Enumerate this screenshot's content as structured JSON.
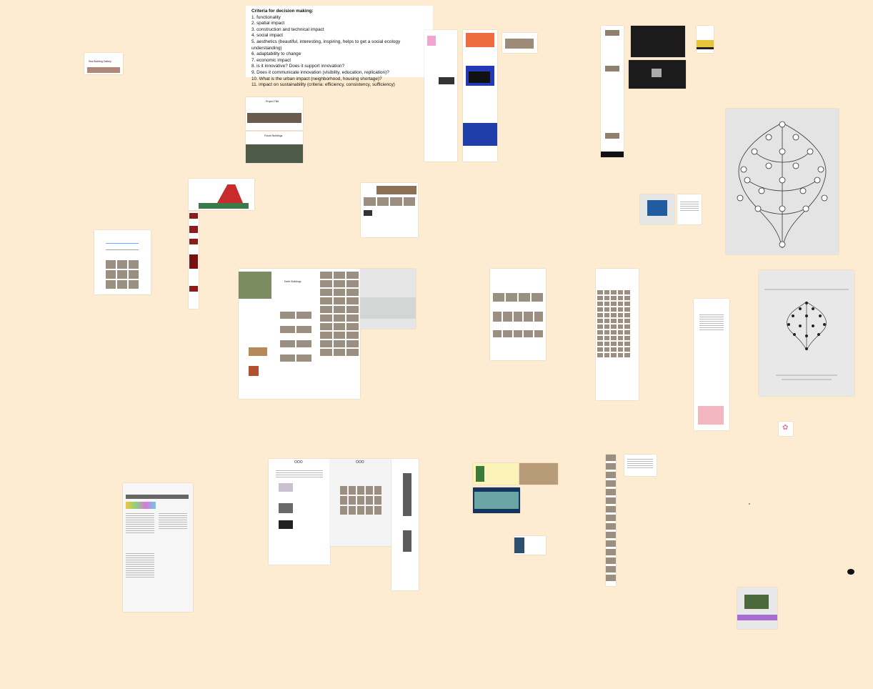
{
  "canvas": {
    "background": "#fdecd2"
  },
  "criteria_note": {
    "title": "Criteria for decision making:",
    "items": [
      "1. functionality",
      "2. spatial impact",
      "3. construction and technical impact",
      "4. social impact",
      "5. aesthetics (beautiful, interesting, inspiring, helps to get a social ecology understanding)",
      "6. adaptability to change",
      "7. economic impact",
      "8. is it innovative? Does it support innovation?",
      "9. Does it communicate innovation (visibility, education, replication)?",
      "10. What is the urban impact (neighborhood, housing shortage)?",
      "11. impact on sustainability (criteria: efficiency, consistency, sufficiency)"
    ]
  },
  "cards": {
    "small_card_1": {
      "heading": "Sea Building Gallery"
    },
    "project_card": {
      "heading": "Project Title"
    },
    "mid_card": {
      "heading": "Future Buildings"
    },
    "center_card": {
      "heading": "Earth Buildings"
    },
    "ooo_card_1": {
      "heading": "OOO"
    },
    "ooo_card_2": {
      "heading": "OOO"
    }
  },
  "icons": {
    "cursor": "cursor-icon",
    "pink_sticker": "pink-flower-icon"
  }
}
